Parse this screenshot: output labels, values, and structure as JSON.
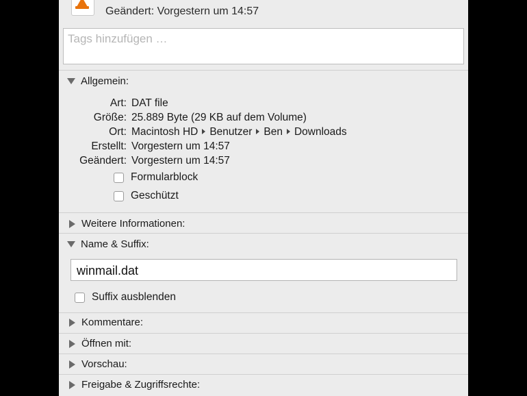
{
  "header": {
    "modified_label": "Geändert:",
    "modified_value": "Vorgestern um 14:57",
    "icon": "vlc-cone-icon"
  },
  "tags": {
    "placeholder": "Tags hinzufügen …",
    "value": ""
  },
  "general": {
    "title": "Allgemein:",
    "expanded": true,
    "rows": [
      {
        "label": "Art:",
        "value": "DAT file"
      },
      {
        "label": "Größe:",
        "value": "25.889 Byte (29 KB auf dem Volume)"
      },
      {
        "label": "Ort:",
        "path": [
          "Macintosh HD",
          "Benutzer",
          "Ben",
          "Downloads"
        ]
      },
      {
        "label": "Erstellt:",
        "value": "Vorgestern um 14:57"
      },
      {
        "label": "Geändert:",
        "value": "Vorgestern um 14:57"
      }
    ],
    "checkboxes": [
      {
        "label": "Formularblock",
        "checked": false
      },
      {
        "label": "Geschützt",
        "checked": false
      }
    ]
  },
  "more_info": {
    "title": "Weitere Informationen:",
    "expanded": false
  },
  "name_suffix": {
    "title": "Name & Suffix:",
    "expanded": true,
    "filename": "winmail.dat",
    "hide_suffix_label": "Suffix ausblenden",
    "hide_suffix_checked": false
  },
  "collapsed_sections": [
    {
      "title": "Kommentare:"
    },
    {
      "title": "Öffnen mit:"
    },
    {
      "title": "Vorschau:"
    },
    {
      "title": "Freigabe & Zugriffsrechte:"
    }
  ],
  "colors": {
    "panel_bg": "#ececec",
    "backdrop": "#000000",
    "cone": "#e8730c"
  }
}
